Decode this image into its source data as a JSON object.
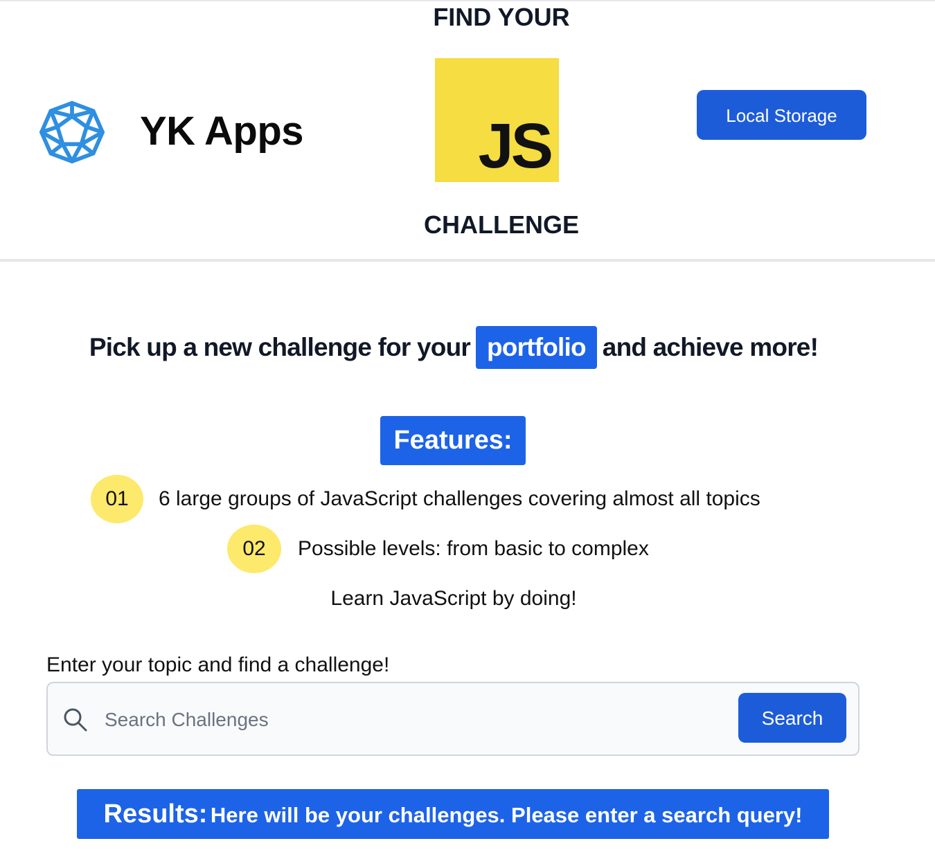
{
  "header": {
    "brand_name": "YK Apps",
    "logo_icon": "geodesic-sphere-icon",
    "title_top": "FIND YOUR",
    "js_logo_text": "JS",
    "title_bottom": "CHALLENGE",
    "local_storage_label": "Local Storage"
  },
  "hero": {
    "tagline_before": "Pick up a new challenge for your",
    "tagline_highlight": "portfolio",
    "tagline_after": "and achieve more!",
    "features_label": "Features:",
    "features": [
      {
        "number": "01",
        "text": "6 large groups of JavaScript challenges covering almost all topics"
      },
      {
        "number": "02",
        "text": "Possible levels: from basic to complex"
      }
    ],
    "learn_line": "Learn JavaScript by doing!"
  },
  "search": {
    "label": "Enter your topic and find a challenge!",
    "placeholder": "Search Challenges",
    "value": "",
    "button_label": "Search",
    "icon": "search-icon"
  },
  "results": {
    "title": "Results:",
    "message": "Here will be your challenges. Please enter a search query!"
  },
  "colors": {
    "primary_blue": "#1d63e8",
    "button_blue": "#1d5cd9",
    "js_yellow": "#f5dd42",
    "badge_yellow": "#fde96b",
    "logo_blue": "#2f8fe0"
  }
}
